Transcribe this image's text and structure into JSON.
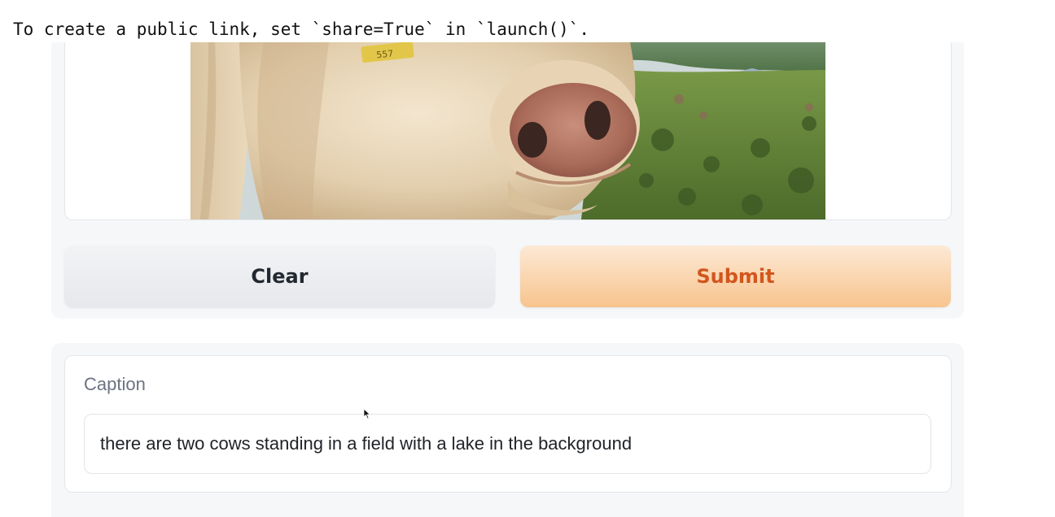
{
  "console": {
    "message": "To create a public link, set `share=True` in `launch()`."
  },
  "input": {
    "image_alt": "Close-up of a white cow's nose in a grassy field",
    "image_tag_text": "557"
  },
  "buttons": {
    "clear_label": "Clear",
    "submit_label": "Submit"
  },
  "output": {
    "label": "Caption",
    "value": "there are two cows standing in a field with a lake in the background"
  },
  "colors": {
    "submit_text": "#d2561e",
    "submit_bg_top": "#fde9d5",
    "submit_bg_bottom": "#f7c48e",
    "panel_bg": "#f6f7f9"
  },
  "icons": {
    "cursor": "mouse-pointer-icon"
  }
}
